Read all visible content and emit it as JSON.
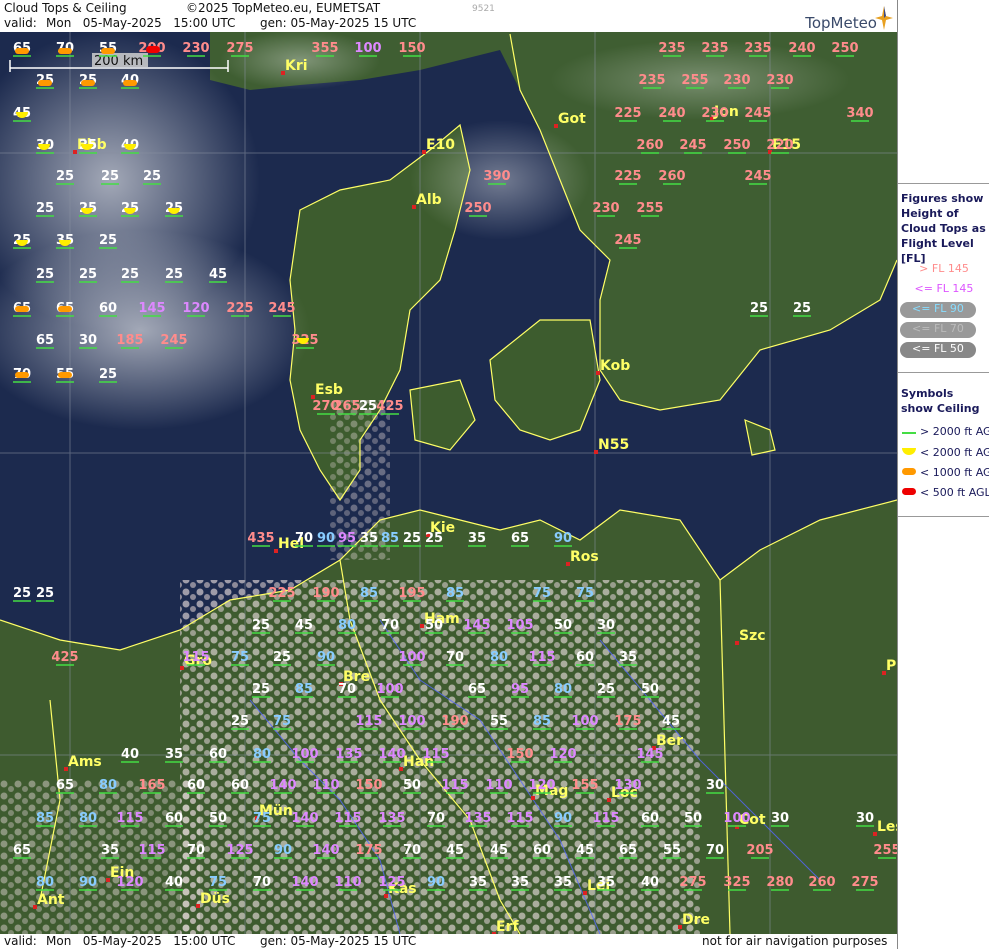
{
  "header": {
    "title": "Cloud Tops & Ceiling",
    "copyright": "©2025 TopMeteo.eu, EUMETSAT",
    "valid_label": "valid:",
    "valid_value": "Mon   05-May-2025   15:00 UTC",
    "gen_value": "gen: 05-May-2025 15 UTC",
    "image_id": "9521",
    "brand": "TopMeteo"
  },
  "footer": {
    "valid_label": "valid:",
    "valid_value": "Mon   05-May-2025   15:00 UTC",
    "gen_value": "gen: 05-May-2025 15 UTC",
    "disclaimer": "not for air navigation purposes"
  },
  "scale": {
    "label": "200 km"
  },
  "colors": {
    "high": "#ff8c8c",
    "mid": "#dd88ff",
    "low_white": "#ffffff",
    "low_blue": "#88ccff",
    "city": "#ffff66",
    "sea": "#1c2a4e",
    "land": "#3d5c2e",
    "ceil_ok": "#44dd44",
    "ceil_2000": "#ffee00",
    "ceil_1000": "#ff9900",
    "ceil_500": "#ee0000"
  },
  "legend": {
    "figures_title": "Figures show Height of Cloud Tops as Flight Level  [FL]",
    "items": [
      {
        "text": "> FL 145",
        "color": "#ff8c8c"
      },
      {
        "text": "<= FL 145",
        "color": "#dd55ff"
      },
      {
        "text": "<= FL 90",
        "color": "#88ddff"
      },
      {
        "text": "<= FL 70",
        "color": "#bbbbbb"
      },
      {
        "text": "<= FL 50",
        "color": "#ffffff"
      }
    ],
    "symbols_title": "Symbols show Ceiling",
    "symbols": [
      {
        "text": "> 2000 ft AGL",
        "icon": "green-line"
      },
      {
        "text": "< 2000 ft AGL",
        "icon": "yellow-half"
      },
      {
        "text": "< 1000 ft AGL",
        "icon": "orange-pill"
      },
      {
        "text": "< 500 ft AGL",
        "icon": "red-pill"
      }
    ]
  },
  "cities": [
    {
      "name": "Kri"
    },
    {
      "name": "Got"
    },
    {
      "name": "Jon"
    },
    {
      "name": "E15"
    },
    {
      "name": "E10"
    },
    {
      "name": "Alb"
    },
    {
      "name": "Ebb"
    },
    {
      "name": "Kob"
    },
    {
      "name": "Esb"
    },
    {
      "name": "N55"
    },
    {
      "name": "Kie"
    },
    {
      "name": "Hel"
    },
    {
      "name": "Ros"
    },
    {
      "name": "Ham"
    },
    {
      "name": "Szc"
    },
    {
      "name": "Gro"
    },
    {
      "name": "Bre"
    },
    {
      "name": "Ber"
    },
    {
      "name": "Ams"
    },
    {
      "name": "Han"
    },
    {
      "name": "Mag"
    },
    {
      "name": "Loc"
    },
    {
      "name": "Cot"
    },
    {
      "name": "Mün"
    },
    {
      "name": "Les"
    },
    {
      "name": "Ein"
    },
    {
      "name": "Kas"
    },
    {
      "name": "Lei"
    },
    {
      "name": "Ant"
    },
    {
      "name": "Düs"
    },
    {
      "name": "Erf"
    },
    {
      "name": "Dre"
    },
    {
      "name": "P"
    }
  ],
  "cloud_labels": [
    "65",
    "70",
    "55",
    "200",
    "230",
    "275",
    "355",
    "100",
    "150",
    "235",
    "235",
    "235",
    "240",
    "250",
    "25",
    "25",
    "40",
    "235",
    "255",
    "230",
    "230",
    "45",
    "225",
    "240",
    "230",
    "245",
    "340",
    "30",
    "25",
    "40",
    "260",
    "245",
    "250",
    "220",
    "25",
    "25",
    "25",
    "390",
    "225",
    "260",
    "245",
    "25",
    "25",
    "25",
    "25",
    "250",
    "230",
    "255",
    "25",
    "35",
    "25",
    "245",
    "25",
    "25",
    "25",
    "25",
    "45",
    "65",
    "65",
    "60",
    "145",
    "120",
    "225",
    "245",
    "25",
    "25",
    "65",
    "30",
    "185",
    "245",
    "325",
    "70",
    "55",
    "25",
    "425",
    "25",
    "265",
    "270",
    "90",
    "35",
    "25",
    "435",
    "70",
    "95",
    "85",
    "25",
    "35",
    "65",
    "90",
    "25",
    "25",
    "225",
    "190",
    "85",
    "195",
    "85",
    "75",
    "75",
    "25",
    "45",
    "80",
    "70",
    "50",
    "145",
    "105",
    "50",
    "30",
    "425",
    "115",
    "75",
    "25",
    "90",
    "100",
    "70",
    "80",
    "115",
    "60",
    "35",
    "25",
    "85",
    "70",
    "100",
    "65",
    "95",
    "80",
    "25",
    "50",
    "25",
    "75",
    "115",
    "100",
    "190",
    "55",
    "85",
    "100",
    "175",
    "45",
    "40",
    "35",
    "60",
    "80",
    "100",
    "135",
    "140",
    "115",
    "150",
    "120",
    "145",
    "65",
    "80",
    "165",
    "60",
    "60",
    "140",
    "110",
    "150",
    "50",
    "115",
    "110",
    "120",
    "155",
    "130",
    "30",
    "85",
    "80",
    "115",
    "60",
    "50",
    "75",
    "140",
    "115",
    "135",
    "70",
    "135",
    "115",
    "90",
    "115",
    "60",
    "50",
    "100",
    "30",
    "30",
    "65",
    "35",
    "115",
    "70",
    "125",
    "90",
    "140",
    "175",
    "70",
    "45",
    "45",
    "60",
    "45",
    "65",
    "55",
    "70",
    "205",
    "255",
    "80",
    "90",
    "120",
    "40",
    "75",
    "70",
    "140",
    "110",
    "125",
    "90",
    "35",
    "35",
    "35",
    "35",
    "40",
    "275",
    "325",
    "280",
    "260",
    "275"
  ]
}
